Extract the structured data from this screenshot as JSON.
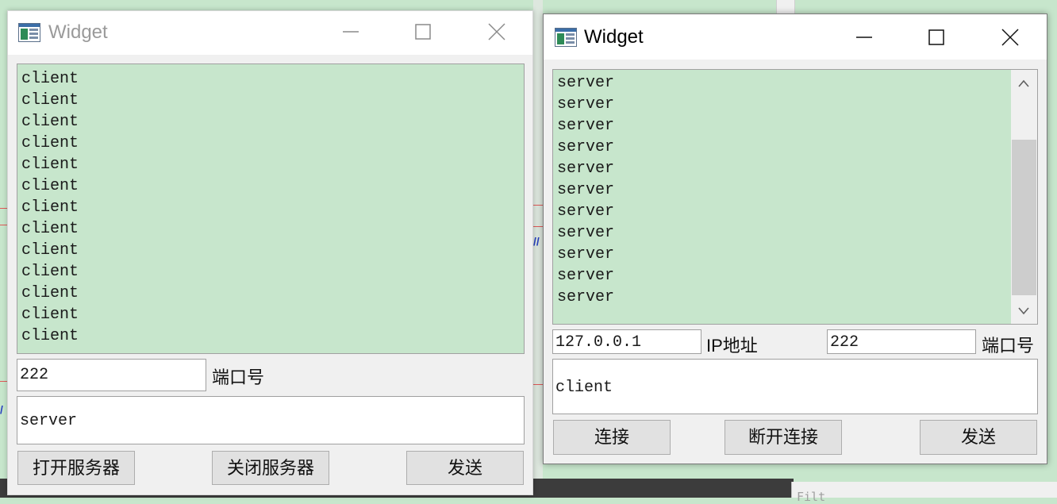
{
  "client_window": {
    "title": "Widget",
    "messages": [
      "client",
      "client",
      "client",
      "client",
      "client",
      "client",
      "client",
      "client",
      "client",
      "client",
      "client",
      "client",
      "client"
    ],
    "port_value": "222",
    "port_label": "端口号",
    "message_input": "server",
    "open_server_label": "打开服务器",
    "close_server_label": "关闭服务器",
    "send_label": "发送"
  },
  "server_window": {
    "title": "Widget",
    "messages": [
      "server",
      "server",
      "server",
      "server",
      "server",
      "server",
      "server",
      "server",
      "server",
      "server",
      "server"
    ],
    "ip_value": "127.0.0.1",
    "ip_label": "IP地址",
    "port_value": "222",
    "port_label": "端口号",
    "message_input": "client",
    "connect_label": "连接",
    "disconnect_label": "断开连接",
    "send_label": "发送"
  },
  "background": {
    "panel_text": "Filt"
  },
  "colors": {
    "text_area_bg": "#c7e6cc",
    "window_bg": "#f0f0f0",
    "button_bg": "#e1e1e1"
  }
}
